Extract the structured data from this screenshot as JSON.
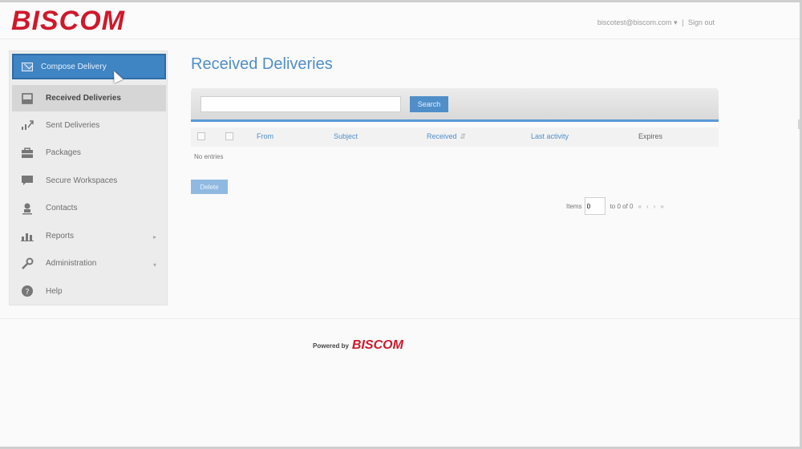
{
  "header": {
    "logo_text": "BISCOM",
    "user_email": "biscotest@biscom.com",
    "user_caret": "▾",
    "separator": "|",
    "sign_out": "Sign out"
  },
  "sidebar": {
    "compose_label": "Compose Delivery",
    "items": [
      {
        "label": "Received Deliveries",
        "icon": "inbox-icon",
        "active": true
      },
      {
        "label": "Sent Deliveries",
        "icon": "sent-icon"
      },
      {
        "label": "Packages",
        "icon": "package-icon"
      },
      {
        "label": "Secure Workspaces",
        "icon": "workspace-icon"
      },
      {
        "label": "Contacts",
        "icon": "contacts-icon"
      },
      {
        "label": "Reports",
        "icon": "reports-icon",
        "expandable": true
      },
      {
        "label": "Administration",
        "icon": "wrench-icon",
        "expandable": true
      },
      {
        "label": "Help",
        "icon": "help-icon"
      }
    ]
  },
  "main": {
    "title": "Received Deliveries",
    "search": {
      "value": "",
      "button_label": "Search"
    },
    "table": {
      "columns": [
        "From",
        "Subject",
        "Received",
        "Last activity",
        "Expires"
      ],
      "empty_text": "No entries"
    },
    "delete_label": "Delete",
    "pager": {
      "items_label": "Items",
      "items_value": "0",
      "range_text": "to 0 of 0",
      "nav": [
        "«",
        "‹",
        "›",
        "»"
      ]
    }
  },
  "footer": {
    "powered_by": "Powered by",
    "logo_text": "BISCOM"
  },
  "colors": {
    "brand_red": "#d0182b",
    "accent_blue": "#4f8ec9"
  }
}
